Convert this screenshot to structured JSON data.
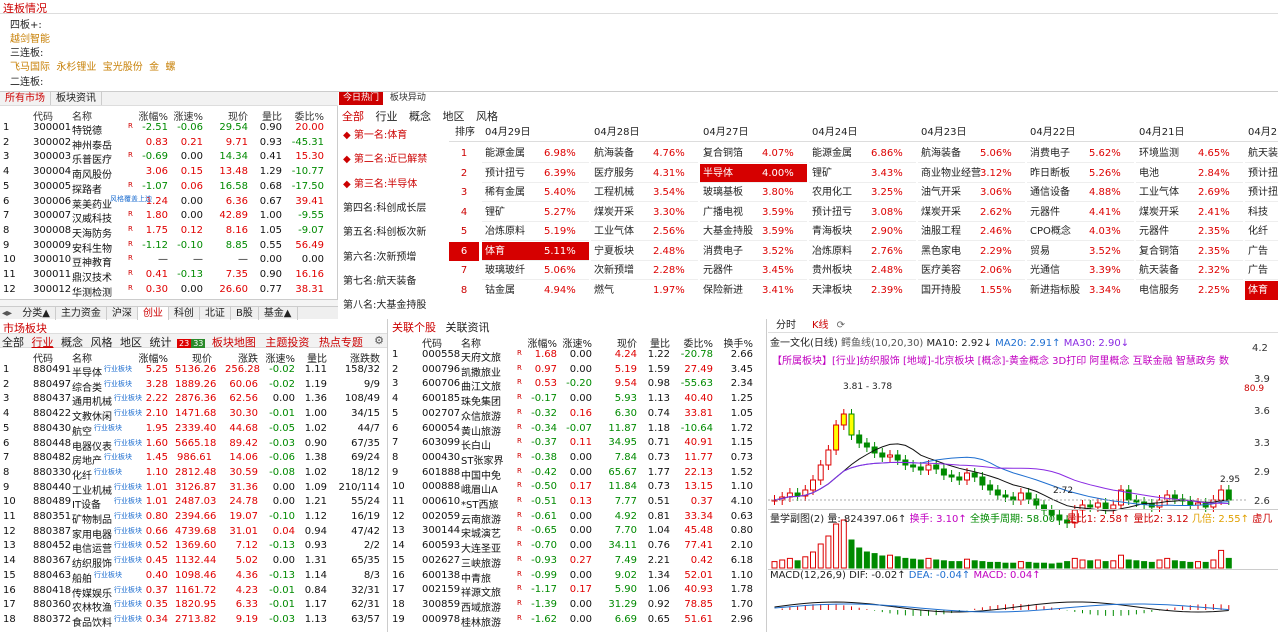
{
  "lianban": {
    "title": "连板情况",
    "rows": [
      {
        "label": "四板+:",
        "stocks": [
          "越剑智能"
        ]
      },
      {
        "label": "三连板:",
        "stocks": [
          "飞马国际",
          "永杉锂业",
          "宝光股份",
          "金",
          "螺"
        ]
      },
      {
        "label": "二连板:",
        "stocks": []
      }
    ]
  },
  "market_tabs": [
    "所有市场",
    "板块资讯"
  ],
  "stock_table": {
    "headers": [
      "代码",
      "名称",
      "涨幅%",
      "涨速%",
      "现价",
      "量比",
      "委比%"
    ],
    "rows": [
      [
        "1",
        "300001",
        "特锐德",
        "R",
        "-2.51",
        "-0.06",
        "29.54",
        "0.90",
        "20.00"
      ],
      [
        "2",
        "300002",
        "神州泰岳",
        "",
        "0.83",
        "0.21",
        "9.71",
        "0.93",
        "-45.31"
      ],
      [
        "3",
        "300003",
        "乐普医疗",
        "R",
        "-0.69",
        "0.00",
        "14.34",
        "0.41",
        "15.30"
      ],
      [
        "4",
        "300004",
        "南风股份",
        "",
        "3.06",
        "0.15",
        "13.48",
        "1.29",
        "-10.77"
      ],
      [
        "5",
        "300005",
        "探路者",
        "R",
        "-1.07",
        "0.06",
        "16.58",
        "0.68",
        "-17.50"
      ],
      [
        "6",
        "300006",
        "莱美药业",
        "",
        "1.24",
        "0.00",
        "6.36",
        "0.67",
        "39.41"
      ],
      [
        "7",
        "300007",
        "汉威科技",
        "R",
        "1.80",
        "0.00",
        "42.89",
        "1.00",
        "-9.55"
      ],
      [
        "8",
        "300008",
        "天海防务",
        "R",
        "1.75",
        "0.12",
        "8.16",
        "1.05",
        "-9.07"
      ],
      [
        "9",
        "300009",
        "安科生物",
        "R",
        "-1.12",
        "-0.10",
        "8.85",
        "0.55",
        "56.49"
      ],
      [
        "10",
        "300010",
        "豆神教育",
        "R",
        "—",
        "—",
        "—",
        "0.00",
        "0.00"
      ],
      [
        "11",
        "300011",
        "鼎汉技术",
        "R",
        "0.41",
        "-0.13",
        "7.35",
        "0.90",
        "16.16"
      ],
      [
        "12",
        "300012",
        "华测检测",
        "R",
        "0.30",
        "0.00",
        "26.60",
        "0.77",
        "38.31"
      ]
    ],
    "extra_tag": "风格覆盖上边"
  },
  "bottom_tabs": [
    "分类▲",
    "主力资金",
    "沪深",
    "创业",
    "科创",
    "北证",
    "B股",
    "基金▲"
  ],
  "hot": {
    "tabs": [
      "今日热门",
      "板块异动"
    ],
    "filters": [
      "全部",
      "行业",
      "概念",
      "地区",
      "风格"
    ],
    "ranks": [
      "第一名:体育",
      "第二名:近已解禁",
      "第三名:半导体",
      "第四名:科创成长层",
      "第五名:科创板次新",
      "第六名:次新预增",
      "第七名:航天装备",
      "第八名:大基金持股"
    ],
    "col_header": "排序",
    "dates": [
      "04月29日",
      "04月28日",
      "04月27日",
      "04月24日",
      "04月23日",
      "04月22日",
      "04月21日",
      "04月2"
    ],
    "grid": [
      [
        [
          "能源金属",
          "6.98%"
        ],
        [
          "航海装备",
          "4.76%"
        ],
        [
          "复合铜箔",
          "4.07%"
        ],
        [
          "能源金属",
          "6.86%"
        ],
        [
          "航海装备",
          "5.06%"
        ],
        [
          "消费电子",
          "5.62%"
        ],
        [
          "环境监测",
          "4.65%"
        ],
        [
          "航天装",
          ""
        ]
      ],
      [
        [
          "预计扭亏",
          "6.39%"
        ],
        [
          "医疗服务",
          "4.31%"
        ],
        [
          "半导体",
          "4.00%"
        ],
        [
          "锂矿",
          "3.43%"
        ],
        [
          "商业物业经营",
          "3.12%"
        ],
        [
          "昨日断板",
          "5.26%"
        ],
        [
          "电池",
          "2.84%"
        ],
        [
          "预计扭",
          ""
        ]
      ],
      [
        [
          "稀有金属",
          "5.40%"
        ],
        [
          "工程机械",
          "3.54%"
        ],
        [
          "玻璃基板",
          "3.80%"
        ],
        [
          "农用化工",
          "3.25%"
        ],
        [
          "油气开采",
          "3.06%"
        ],
        [
          "通信设备",
          "4.88%"
        ],
        [
          "工业气体",
          "2.69%"
        ],
        [
          "预计扭",
          ""
        ]
      ],
      [
        [
          "锂矿",
          "5.27%"
        ],
        [
          "煤炭开采",
          "3.30%"
        ],
        [
          "广播电视",
          "3.59%"
        ],
        [
          "预计扭亏",
          "3.08%"
        ],
        [
          "煤炭开采",
          "2.62%"
        ],
        [
          "元器件",
          "4.41%"
        ],
        [
          "煤炭开采",
          "2.41%"
        ],
        [
          "科技",
          ""
        ]
      ],
      [
        [
          "冶炼原料",
          "5.19%"
        ],
        [
          "工业气体",
          "2.56%"
        ],
        [
          "大基金持股",
          "3.59%"
        ],
        [
          "青海板块",
          "2.90%"
        ],
        [
          "油服工程",
          "2.46%"
        ],
        [
          "CPO概念",
          "4.03%"
        ],
        [
          "元器件",
          "2.35%"
        ],
        [
          "化纤",
          ""
        ]
      ],
      [
        [
          "体育",
          "5.11%"
        ],
        [
          "宁夏板块",
          "2.48%"
        ],
        [
          "消费电子",
          "3.52%"
        ],
        [
          "冶炼原料",
          "2.76%"
        ],
        [
          "黑色家电",
          "2.29%"
        ],
        [
          "贸易",
          "3.52%"
        ],
        [
          "复合铜箔",
          "2.35%"
        ],
        [
          "广告",
          ""
        ]
      ],
      [
        [
          "玻璃玻纤",
          "5.06%"
        ],
        [
          "次新预增",
          "2.28%"
        ],
        [
          "元器件",
          "3.45%"
        ],
        [
          "贵州板块",
          "2.48%"
        ],
        [
          "医疗美容",
          "2.06%"
        ],
        [
          "光通信",
          "3.39%"
        ],
        [
          "航天装备",
          "2.32%"
        ],
        [
          "广告",
          ""
        ]
      ],
      [
        [
          "钴金属",
          "4.94%"
        ],
        [
          "燃气",
          "1.97%"
        ],
        [
          "保险新进",
          "3.41%"
        ],
        [
          "天津板块",
          "2.39%"
        ],
        [
          "国开持股",
          "1.55%"
        ],
        [
          "新进指标股",
          "3.34%"
        ],
        [
          "电信服务",
          "2.25%"
        ],
        [
          "体育",
          ""
        ]
      ]
    ]
  },
  "sector": {
    "title": "市场板块",
    "tabs": [
      "全部",
      "行业",
      "概念",
      "风格",
      "地区",
      "统计"
    ],
    "counts": [
      "23",
      "33"
    ],
    "links": [
      "板块地图",
      "主题投资",
      "热点专题"
    ],
    "headers": [
      "代码",
      "名称",
      "涨幅%",
      "现价",
      "涨跌",
      "涨速%",
      "量比",
      "涨跌数"
    ],
    "rows": [
      [
        "1",
        "880491",
        "半导体",
        "5.25",
        "5136.26",
        "256.28",
        "-0.02",
        "1.11",
        "158/32"
      ],
      [
        "2",
        "880497",
        "综合类",
        "3.28",
        "1889.26",
        "60.06",
        "-0.02",
        "1.19",
        "9/9"
      ],
      [
        "3",
        "880437",
        "通用机械",
        "2.22",
        "2876.36",
        "62.56",
        "0.00",
        "1.36",
        "108/49"
      ],
      [
        "4",
        "880422",
        "文教休闲",
        "2.10",
        "1471.68",
        "30.30",
        "-0.01",
        "1.00",
        "34/15"
      ],
      [
        "5",
        "880430",
        "航空",
        "1.95",
        "2339.40",
        "44.68",
        "-0.05",
        "1.02",
        "44/7"
      ],
      [
        "6",
        "880448",
        "电器仪表",
        "1.60",
        "5665.18",
        "89.42",
        "-0.03",
        "0.90",
        "67/35"
      ],
      [
        "7",
        "880482",
        "房地产",
        "1.45",
        "986.61",
        "14.06",
        "-0.06",
        "1.38",
        "69/24"
      ],
      [
        "8",
        "880330",
        "化纤",
        "1.10",
        "2812.48",
        "30.59",
        "-0.08",
        "1.02",
        "18/12"
      ],
      [
        "9",
        "880440",
        "工业机械",
        "1.01",
        "3126.87",
        "31.36",
        "0.00",
        "1.09",
        "210/114"
      ],
      [
        "10",
        "880489",
        "IT设备",
        "1.01",
        "2487.03",
        "24.78",
        "0.00",
        "1.21",
        "55/24"
      ],
      [
        "11",
        "880351",
        "矿物制品",
        "0.80",
        "2394.66",
        "19.07",
        "-0.10",
        "1.12",
        "16/19"
      ],
      [
        "12",
        "880387",
        "家用电器",
        "0.66",
        "4739.68",
        "31.01",
        "0.04",
        "0.94",
        "47/42"
      ],
      [
        "13",
        "880452",
        "电信运营",
        "0.52",
        "1369.60",
        "7.12",
        "-0.13",
        "0.93",
        "2/2"
      ],
      [
        "14",
        "880367",
        "纺织服饰",
        "0.45",
        "1132.44",
        "5.02",
        "0.00",
        "1.31",
        "65/35"
      ],
      [
        "15",
        "880463",
        "船舶",
        "0.40",
        "1098.46",
        "4.36",
        "-0.13",
        "1.14",
        "8/3"
      ],
      [
        "16",
        "880418",
        "传媒娱乐",
        "0.37",
        "1161.72",
        "4.23",
        "-0.01",
        "0.84",
        "32/31"
      ],
      [
        "17",
        "880360",
        "农林牧渔",
        "0.35",
        "1820.95",
        "6.33",
        "-0.01",
        "1.17",
        "62/31"
      ],
      [
        "18",
        "880372",
        "食品饮料",
        "0.34",
        "2713.82",
        "9.19",
        "-0.03",
        "1.13",
        "63/57"
      ]
    ],
    "row_tag": "行业板块"
  },
  "related": {
    "tabs": [
      "关联个股",
      "关联资讯"
    ],
    "headers": [
      "代码",
      "名称",
      "涨幅%",
      "涨速%",
      "现价",
      "量比",
      "委比%",
      "换手%"
    ],
    "rows": [
      [
        "1",
        "000558",
        "天府文旅",
        "1.68",
        "0.00",
        "4.24",
        "1.22",
        "-20.78",
        "2.66"
      ],
      [
        "2",
        "000796",
        "凯撒旅业",
        "0.97",
        "0.00",
        "5.19",
        "1.59",
        "27.49",
        "3.45"
      ],
      [
        "3",
        "600706",
        "曲江文旅",
        "0.53",
        "-0.20",
        "9.54",
        "0.98",
        "-55.63",
        "2.34"
      ],
      [
        "4",
        "600185",
        "珠免集团",
        "-0.17",
        "0.00",
        "5.93",
        "1.13",
        "40.40",
        "1.25"
      ],
      [
        "5",
        "002707",
        "众信旅游",
        "-0.32",
        "0.16",
        "6.30",
        "0.74",
        "33.81",
        "1.05"
      ],
      [
        "6",
        "600054",
        "黄山旅游",
        "-0.34",
        "-0.07",
        "11.87",
        "1.18",
        "-10.64",
        "1.72"
      ],
      [
        "7",
        "603099",
        "长白山",
        "-0.37",
        "0.11",
        "34.95",
        "0.71",
        "40.91",
        "1.15"
      ],
      [
        "8",
        "000430",
        "ST张家界",
        "-0.38",
        "0.00",
        "7.84",
        "0.73",
        "11.77",
        "0.73"
      ],
      [
        "9",
        "601888",
        "中国中免",
        "-0.42",
        "0.00",
        "65.67",
        "1.77",
        "22.13",
        "1.52"
      ],
      [
        "10",
        "000888",
        "峨眉山A",
        "-0.50",
        "0.17",
        "11.84",
        "0.73",
        "13.15",
        "1.10"
      ],
      [
        "11",
        "000610",
        "*ST西旅",
        "-0.51",
        "0.13",
        "7.77",
        "0.51",
        "0.37",
        "4.10"
      ],
      [
        "12",
        "002059",
        "云南旅游",
        "-0.61",
        "0.00",
        "4.92",
        "0.81",
        "33.34",
        "0.63"
      ],
      [
        "13",
        "300144",
        "宋城演艺",
        "-0.65",
        "0.00",
        "7.70",
        "1.04",
        "45.48",
        "0.80"
      ],
      [
        "14",
        "600593",
        "大连圣亚",
        "-0.70",
        "0.00",
        "34.11",
        "0.76",
        "77.41",
        "2.10"
      ],
      [
        "15",
        "002627",
        "三峡旅游",
        "-0.93",
        "0.27",
        "7.49",
        "2.21",
        "0.42",
        "6.18"
      ],
      [
        "16",
        "600138",
        "中青旅",
        "-0.99",
        "0.00",
        "9.02",
        "1.34",
        "52.01",
        "1.10"
      ],
      [
        "17",
        "002159",
        "祥源文旅",
        "-1.17",
        "0.17",
        "5.90",
        "1.06",
        "40.93",
        "1.78"
      ],
      [
        "18",
        "300859",
        "西域旅游",
        "-1.39",
        "0.00",
        "31.29",
        "0.92",
        "78.85",
        "1.70"
      ],
      [
        "19",
        "000978",
        "桂林旅游",
        "-1.62",
        "0.00",
        "6.69",
        "0.65",
        "51.61",
        "2.96"
      ]
    ]
  },
  "kline": {
    "tabs": [
      "分时",
      "K线"
    ],
    "title": "金一文化(日线)",
    "ind": "鳄鱼线(10,20,30)",
    "ma10": "MA10: 2.92↓",
    "ma20": "MA20: 2.91↑",
    "ma30": "MA30: 2.90↓",
    "info": "【所属板块】[行业]纺织服饰 [地域]-北京板块 [概念]-黄金概念 3D打印 阿里概念 互联金融 智慧政务 数",
    "axis": [
      "4.2",
      "3.9",
      "3.6",
      "3.3",
      "2.9",
      "2.6"
    ],
    "pct": "80.9",
    "hi": "3.81 - 3.78",
    "lo": "2.72",
    "last": "2.95",
    "vol_title": "量学副图(2)",
    "vol": "量: 824397.06↑",
    "huan": "换手: 3.10↑",
    "zhou": "全换手周期: 58.00↑",
    "lb1": "量比1: 2.58↑",
    "lb2": "量比2: 3.12",
    "ji": "几倍: 2.55↑",
    "xu": "虚几",
    "macd_title": "MACD(12,26,9)",
    "dif": "DIF: -0.02↑",
    "dea": "DEA: -0.04↑",
    "macd": "MACD: 0.04↑"
  },
  "colors": {
    "up": "#e00000",
    "down": "#008a00",
    "accent": "#cc0000",
    "tag": "#1f6fd0"
  }
}
